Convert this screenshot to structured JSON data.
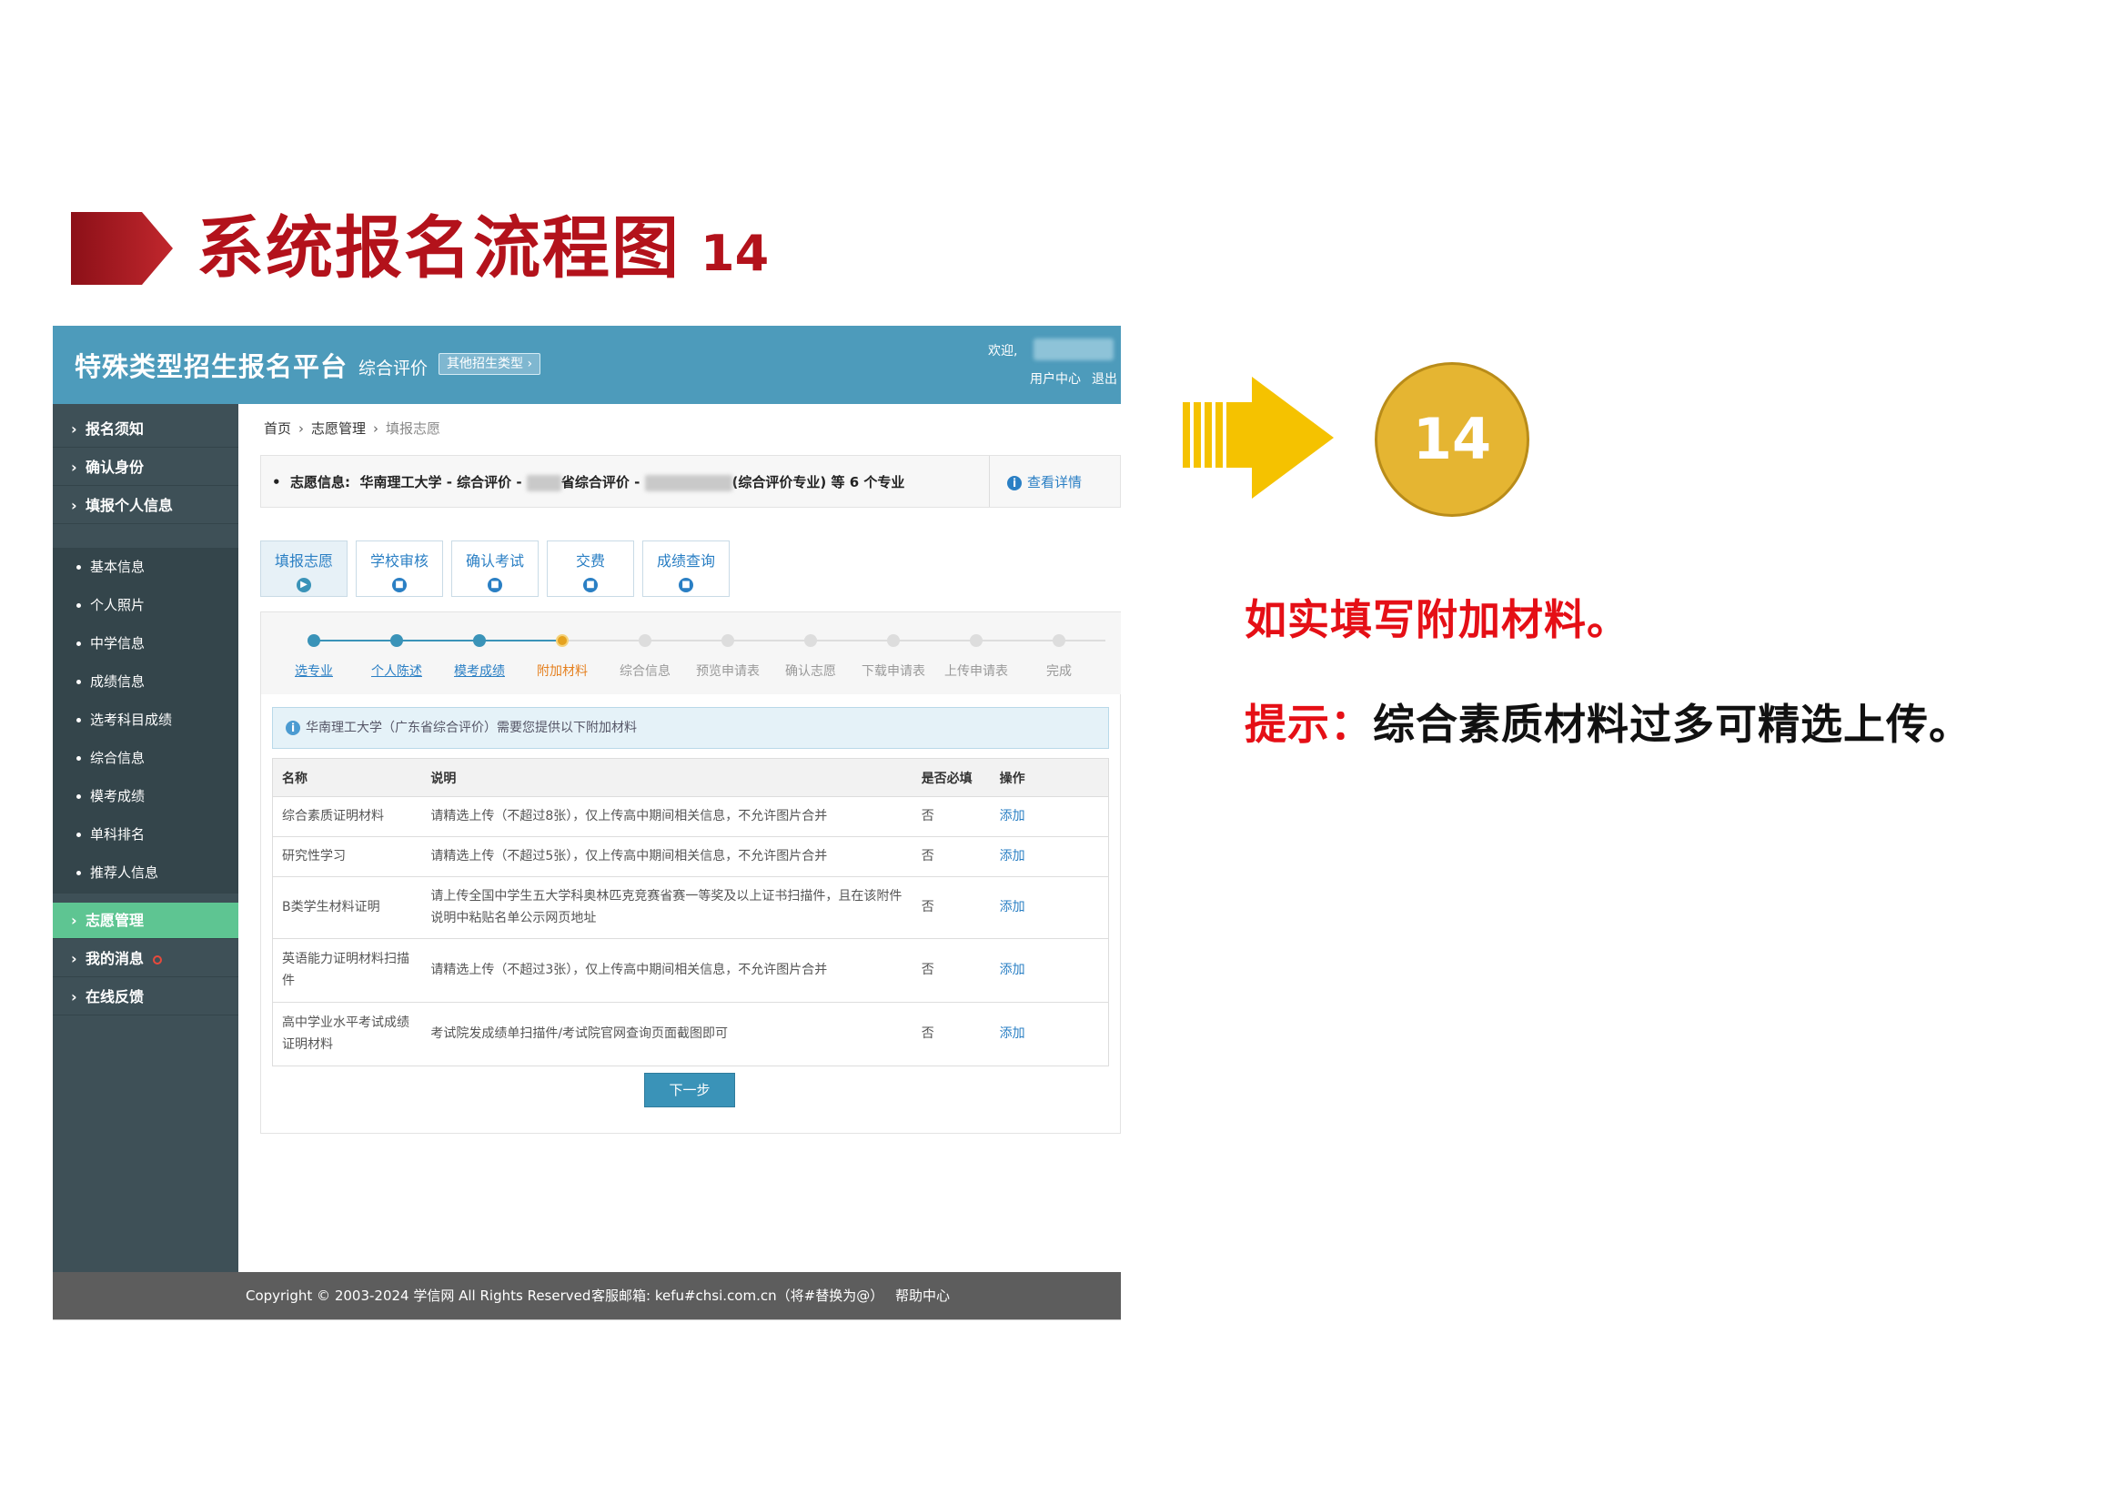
{
  "slide": {
    "title": "系统报名流程图",
    "step": "14",
    "circle_number": "14",
    "note1": "如实填写附加材料。",
    "note2_label": "提示：",
    "note2_text": "综合素质材料过多可精选上传。",
    "accent_red": "#b3121b",
    "arrow_color": "#f5c200"
  },
  "header": {
    "platform": "特殊类型招生报名平台",
    "type": "综合评价",
    "other_type": "其他招生类型 ›",
    "welcome": "欢迎,",
    "user_center": "用户中心",
    "logout": "退出"
  },
  "sidebar": {
    "top_items": [
      "报名须知",
      "确认身份",
      "填报个人信息"
    ],
    "sub_items": [
      "基本信息",
      "个人照片",
      "中学信息",
      "成绩信息",
      "选考科目成绩",
      "综合信息",
      "模考成绩",
      "单科排名",
      "推荐人信息"
    ],
    "bottom_items": [
      "志愿管理",
      "我的消息",
      "在线反馈"
    ],
    "active": "志愿管理"
  },
  "breadcrumb": {
    "home": "首页",
    "section": "志愿管理",
    "current": "填报志愿"
  },
  "info": {
    "prefix": "志愿信息:",
    "text1": "华南理工大学 - 综合评价 -",
    "text2": "省综合评价 -",
    "text3": "(综合评价专业) 等 6 个专业",
    "view_detail": "查看详情"
  },
  "tabs": [
    "填报志愿",
    "学校审核",
    "确认考试",
    "交费",
    "成绩查询"
  ],
  "steps": [
    {
      "label": "选专业",
      "state": "done"
    },
    {
      "label": "个人陈述",
      "state": "done"
    },
    {
      "label": "模考成绩",
      "state": "done"
    },
    {
      "label": "附加材料",
      "state": "current"
    },
    {
      "label": "综合信息",
      "state": "todo"
    },
    {
      "label": "预览申请表",
      "state": "todo"
    },
    {
      "label": "确认志愿",
      "state": "todo"
    },
    {
      "label": "下载申请表",
      "state": "todo"
    },
    {
      "label": "上传申请表",
      "state": "todo"
    },
    {
      "label": "完成",
      "state": "todo"
    }
  ],
  "notice": "华南理工大学（广东省综合评价）需要您提供以下附加材料",
  "table": {
    "headers": [
      "名称",
      "说明",
      "是否必填",
      "操作"
    ],
    "rows": [
      [
        "综合素质证明材料",
        "请精选上传（不超过8张），仅上传高中期间相关信息，不允许图片合并",
        "否",
        "添加"
      ],
      [
        "研究性学习",
        "请精选上传（不超过5张），仅上传高中期间相关信息，不允许图片合并",
        "否",
        "添加"
      ],
      [
        "B类学生材料证明",
        "请上传全国中学生五大学科奥林匹克竞赛省赛一等奖及以上证书扫描件，且在该附件说明中粘贴名单公示网页地址",
        "否",
        "添加"
      ],
      [
        "英语能力证明材料扫描件",
        "请精选上传（不超过3张），仅上传高中期间相关信息，不允许图片合并",
        "否",
        "添加"
      ],
      [
        "高中学业水平考试成绩证明材料",
        "考试院发成绩单扫描件/考试院官网查询页面截图即可",
        "否",
        "添加"
      ]
    ]
  },
  "next_button": "下一步",
  "footer": {
    "copyright": "Copyright © 2003-2024 学信网 All Rights Reserved",
    "email": "客服邮箱: kefu#chsi.com.cn（将#替换为@）",
    "help": "帮助中心"
  }
}
